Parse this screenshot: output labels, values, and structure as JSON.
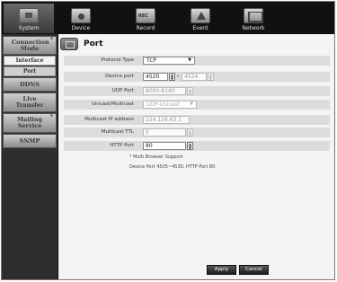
{
  "tabs": [
    {
      "label": "System",
      "icon": "monitor-icon"
    },
    {
      "label": "Device",
      "icon": "camera-icon"
    },
    {
      "label": "Record",
      "icon": "record-icon"
    },
    {
      "label": "Event",
      "icon": "alarm-icon"
    },
    {
      "label": "Network",
      "icon": "network-icon"
    }
  ],
  "sidebar": {
    "connection_mode": "Connection Mode",
    "interface": "Interface",
    "port": "Port",
    "ddns": "DDNS",
    "live_transfer": "Live Transfer",
    "mailing_service": "Mailing Service",
    "snmp": "SNMP",
    "star": "*"
  },
  "page": {
    "title": "Port",
    "icon": "port-settings-icon"
  },
  "form": {
    "protocol_type": {
      "label": "Protocol Type",
      "value": "TCP"
    },
    "device_port": {
      "label": "Device port",
      "start": "4520",
      "end": "4524",
      "separator": "-"
    },
    "udp_port": {
      "label": "UDP Port",
      "value": "8000-8160"
    },
    "unicast_multicast": {
      "label": "Unicast/Multicast",
      "value": "UDP-Unicast"
    },
    "multicast_ip": {
      "label": "Multicast IP address",
      "value": "224.126.63.1"
    },
    "multicast_ttl": {
      "label": "Multicast TTL",
      "value": "5"
    },
    "http_port": {
      "label": "HTTP Port",
      "value": "80"
    }
  },
  "notes": {
    "multi_browser": "* Multi Browser Support",
    "device_port_info": "Device Port 4505~4530, HTTP Port 80"
  },
  "buttons": {
    "apply": "Apply",
    "cancel": "Cancel"
  }
}
